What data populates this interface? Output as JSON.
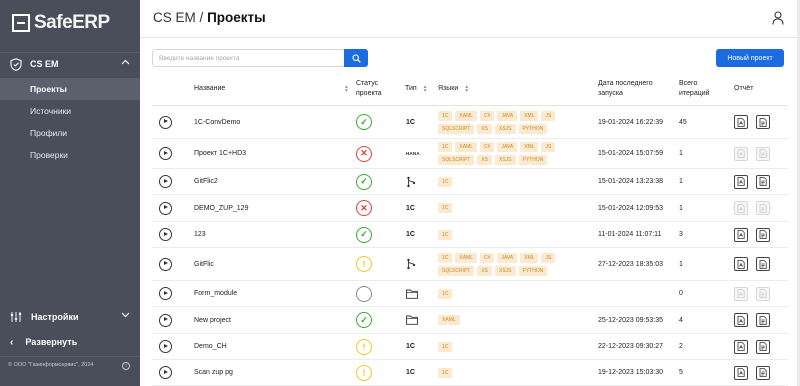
{
  "sidebar": {
    "logo": "SafeERP",
    "section": "CS EM",
    "items": [
      {
        "label": "Проекты",
        "active": true
      },
      {
        "label": "Источники",
        "active": false
      },
      {
        "label": "Профили",
        "active": false
      },
      {
        "label": "Проверки",
        "active": false
      }
    ],
    "settings": "Настройки",
    "expand": "Развернуть",
    "copyright": "© ООО \"Газинформсервис\", 2024"
  },
  "header": {
    "product": "CS EM",
    "separator": "/",
    "page": "Проекты"
  },
  "toolbar": {
    "search_placeholder": "Введите название проекта",
    "new_project": "Новый проект"
  },
  "table": {
    "columns": {
      "name": "Название",
      "status": "Статус проекта",
      "type": "Тип",
      "langs": "Языки",
      "last_run": "Дата последнего запуска",
      "iterations": "Всего итераций",
      "report": "Отчёт"
    },
    "rows": [
      {
        "name": "1C-ConvDemo",
        "status": "ok",
        "type": "1C",
        "langs": [
          "1C",
          "XAML",
          "C#",
          "JAVA",
          "XML",
          "JS",
          "SQLSCRIPT",
          "XS",
          "XSJS",
          "PYTHON"
        ],
        "date": "19-01-2024 16:22:39",
        "iterations": "45",
        "reports": true
      },
      {
        "name": "Проект 1С+HD3",
        "status": "err",
        "type": "HANA",
        "langs": [
          "1C",
          "XAML",
          "C#",
          "JAVA",
          "XML",
          "JS",
          "SQLSCRIPT",
          "XS",
          "XSJS",
          "PYTHON"
        ],
        "date": "15-01-2024 15:07:59",
        "iterations": "1",
        "reports": false
      },
      {
        "name": "GitFlic2",
        "status": "ok",
        "type": "git",
        "langs": [
          "1C"
        ],
        "date": "15-01-2024 13:23:38",
        "iterations": "1",
        "reports": true
      },
      {
        "name": "DEMO_ZUP_129",
        "status": "err",
        "type": "1C",
        "langs": [
          "1C"
        ],
        "date": "15-01-2024 12:09:53",
        "iterations": "1",
        "reports": false
      },
      {
        "name": "123",
        "status": "ok",
        "type": "1C",
        "langs": [
          "1C"
        ],
        "date": "11-01-2024 11:07:11",
        "iterations": "3",
        "reports": true
      },
      {
        "name": "GitFlic",
        "status": "warn",
        "type": "git",
        "langs": [
          "1C",
          "XAML",
          "C#",
          "JAVA",
          "XML",
          "JS",
          "SQLSCRIPT",
          "XS",
          "XSJS",
          "PYTHON"
        ],
        "date": "27-12-2023 18:35:03",
        "iterations": "1",
        "reports": true
      },
      {
        "name": "Form_module",
        "status": "none",
        "type": "folder",
        "langs": [
          "1C"
        ],
        "date": "",
        "iterations": "0",
        "reports": false
      },
      {
        "name": "New project",
        "status": "ok",
        "type": "folder",
        "langs": [
          "XAML"
        ],
        "date": "25-12-2023 09:53:35",
        "iterations": "4",
        "reports": true
      },
      {
        "name": "Demo_CH",
        "status": "warn",
        "type": "1C",
        "langs": [
          "1C"
        ],
        "date": "22-12-2023 09:30:27",
        "iterations": "2",
        "reports": true
      },
      {
        "name": "Scan zup pg",
        "status": "warn",
        "type": "1C",
        "langs": [
          "1C"
        ],
        "date": "19-12-2023 15:03:30",
        "iterations": "5",
        "reports": true
      }
    ]
  },
  "colors": {
    "sidebar": "#4a4e5a",
    "accent": "#1a6ce0",
    "ok": "#3aaa35",
    "err": "#e0403a",
    "warn": "#f2c624",
    "tag_bg": "#fbeacf",
    "tag_text": "#c58a2a"
  }
}
